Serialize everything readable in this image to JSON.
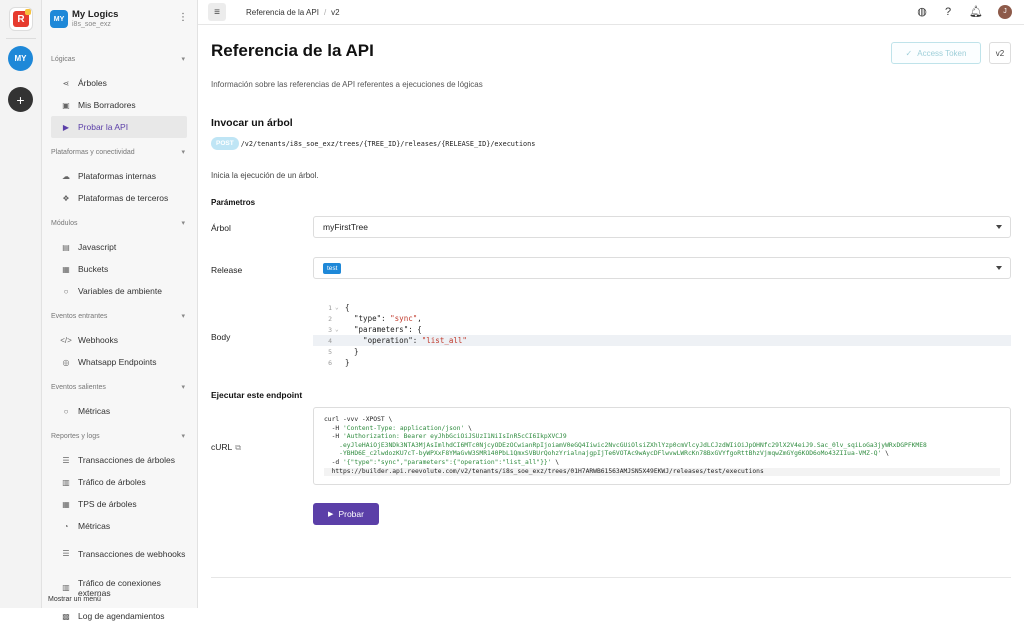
{
  "rail": {
    "avatar": "MY",
    "add": "+"
  },
  "project": {
    "badge": "MY",
    "name": "My Logics",
    "sub": "i8s_soe_exz"
  },
  "sidebar": {
    "sections": [
      {
        "title": "Lógicas",
        "items": [
          {
            "label": "Árboles",
            "icon": "share-icon"
          },
          {
            "label": "Mis Borradores",
            "icon": "image-icon"
          },
          {
            "label": "Probar la API",
            "icon": "play-icon",
            "active": true
          }
        ]
      },
      {
        "title": "Plataformas y conectividad",
        "items": [
          {
            "label": "Plataformas internas",
            "icon": "cloud-icon"
          },
          {
            "label": "Plataformas de terceros",
            "icon": "cubes-icon"
          }
        ]
      },
      {
        "title": "Módulos",
        "items": [
          {
            "label": "Javascript",
            "icon": "file-icon"
          },
          {
            "label": "Buckets",
            "icon": "archive-icon"
          },
          {
            "label": "Variables de ambiente",
            "icon": "circle-icon"
          }
        ]
      },
      {
        "title": "Eventos entrantes",
        "items": [
          {
            "label": "Webhooks",
            "icon": "code-icon"
          },
          {
            "label": "Whatsapp Endpoints",
            "icon": "whatsapp-icon"
          }
        ]
      },
      {
        "title": "Eventos salientes",
        "items": [
          {
            "label": "Métricas",
            "icon": "circle-icon"
          }
        ]
      },
      {
        "title": "Reportes y logs",
        "items": [
          {
            "label": "Transacciones de árboles",
            "icon": "list-icon"
          },
          {
            "label": "Tráfico de árboles",
            "icon": "chart-icon"
          },
          {
            "label": "TPS de árboles",
            "icon": "table-icon"
          },
          {
            "label": "Métricas",
            "icon": "gauge-icon"
          },
          {
            "label": "Transacciones de webhooks",
            "icon": "list-icon",
            "two": true
          },
          {
            "label": "Tráfico de conexiones externas",
            "icon": "chart-icon",
            "two": true
          },
          {
            "label": "Log de agendamientos",
            "icon": "calendar-icon"
          }
        ]
      }
    ],
    "show_menu": "Mostrar un menú"
  },
  "topbar": {
    "crumb1": "Referencia de la API",
    "crumb2": "v2",
    "avatar": "J"
  },
  "main": {
    "title": "Referencia de la API",
    "token_label": "Access Token",
    "version_label": "v2",
    "description": "Información sobre las referencias de API referentes a ejecuciones de lógicas",
    "section_title": "Invocar un árbol",
    "method": "POST",
    "path": "/v2/tenants/i8s_soe_exz/trees/{TREE_ID}/releases/{RELEASE_ID}/executions",
    "invoke_description": "Inicia la ejecución de un árbol.",
    "params_title": "Parámetros",
    "tree_label": "Árbol",
    "tree_value": "myFirstTree",
    "release_label": "Release",
    "release_value": "test",
    "body_label": "Body",
    "execute_title": "Ejecutar este endpoint",
    "curl_label": "cURL",
    "run_label": "Probar"
  },
  "body_lines": [
    {
      "n": "1",
      "fold": "⌄",
      "text": "{"
    },
    {
      "n": "2",
      "fold": "",
      "text": "  \"type\": ",
      "str": "\"sync\"",
      "tail": ","
    },
    {
      "n": "3",
      "fold": "⌄",
      "text": "  \"parameters\": {"
    },
    {
      "n": "4",
      "fold": "",
      "text": "    \"operation\": ",
      "str": "\"list_all\"",
      "tail": "",
      "hl": true
    },
    {
      "n": "5",
      "fold": "",
      "text": "  }"
    },
    {
      "n": "6",
      "fold": "",
      "text": "}"
    }
  ],
  "curl_lines": [
    {
      "a": "curl -vvv -XPOST \\"
    },
    {
      "a": "  -H ",
      "g": "'Content-Type: application/json'",
      "b": " \\"
    },
    {
      "a": "  -H ",
      "g": "'Authorization: Bearer eyJhbGciOiJSUzI1NiIsInR5cCI6IkpXVCJ9",
      "b": ""
    },
    {
      "a": "",
      "g": "    .eyJleHAiOjE3NDk3NTA3MjAsImlhdCI6MTc0NjcyODEzOCwianRpIjoiamV0eGQ4Iiwic2NvcGUiOlsiZXhlYzp0cmVlcyJdLCJzdWIiOiJpOHNfc29lX2V4eiJ9.Sac_0lv_sqiLoGa3jyWRxDGPFKME8",
      "b": ""
    },
    {
      "a": "",
      "g": "    -YBHD6E_c2lwdozKU7cT-byWPXxF8YMaGvW3SMR140PbL1QmxSVBUrQohzYrialnajgpIjTe6VOTAc9wAycDFlwvwLWRcKn78BxGVYfgoRttBhzVjmqwZmGYg6KOD6oMo43ZIIua-VMZ-Q'",
      "b": " \\"
    },
    {
      "a": "  -d ",
      "g": "'{\"type\":\"sync\",\"parameters\":{\"operation\":\"list_all\"}}'",
      "b": " \\"
    },
    {
      "a": "  https://builder.api.reevolute.com/v2/tenants/i8s_soe_exz/trees/01H7ARWB61563AMJSN5X49EKWJ/releases/test/executions",
      "g": "",
      "b": "",
      "last": true
    }
  ]
}
